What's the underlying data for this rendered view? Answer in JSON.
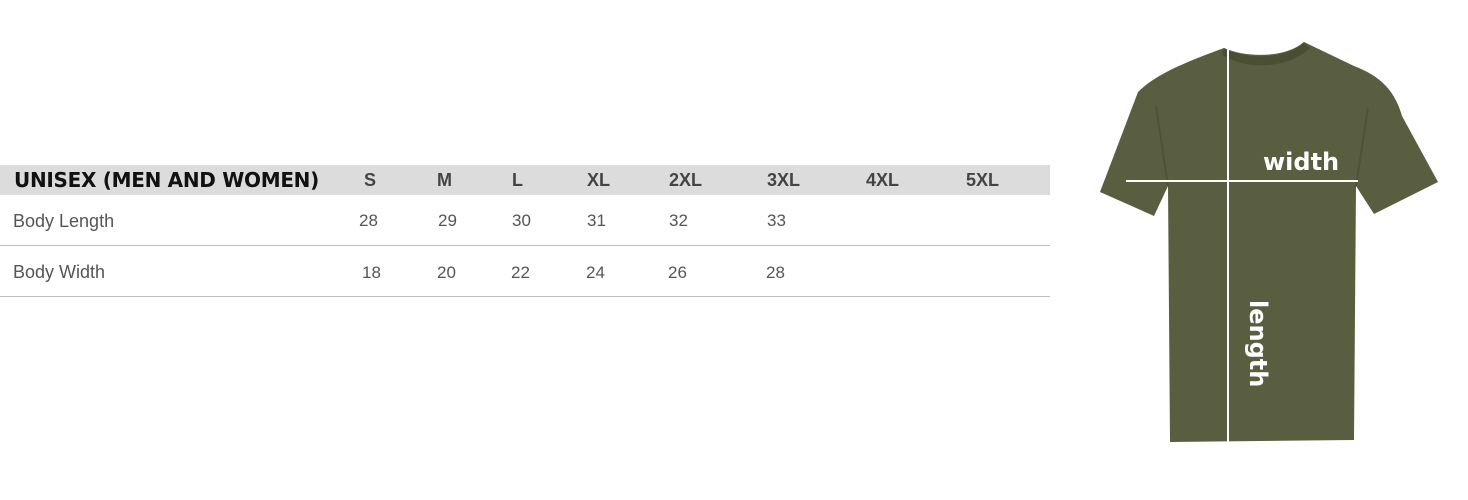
{
  "table": {
    "title": "UNISEX (MEN AND WOMEN)",
    "sizes": [
      "S",
      "M",
      "L",
      "XL",
      "2XL",
      "3XL",
      "4XL",
      "5XL"
    ],
    "rows": [
      {
        "label": "Body Length",
        "values": [
          "28",
          "29",
          "30",
          "31",
          "32",
          "33",
          "",
          ""
        ]
      },
      {
        "label": "Body Width",
        "values": [
          "18",
          "20",
          "22",
          "24",
          "26",
          "28",
          "",
          ""
        ]
      }
    ]
  },
  "illustration": {
    "width_label": "width",
    "length_label": "length",
    "shirt_color": "#5a5e40",
    "shirt_shadow": "#4a4e33",
    "measure_line_color": "#ffffff"
  }
}
